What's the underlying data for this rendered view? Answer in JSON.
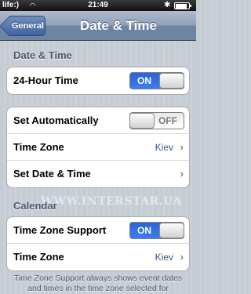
{
  "status_bar": {
    "carrier": "life:)",
    "wifi_icon": "wifi-icon",
    "time": "21:49",
    "bluetooth_icon": "bluetooth-icon",
    "battery_icon": "battery-icon",
    "battery_level": 0.8
  },
  "nav": {
    "back_label": "General",
    "title": "Date & Time"
  },
  "sections": {
    "date_time": {
      "header": "Date & Time",
      "hour24": {
        "label": "24-Hour Time",
        "state": "ON"
      }
    },
    "auto": {
      "set_automatically": {
        "label": "Set Automatically",
        "state": "OFF"
      },
      "time_zone": {
        "label": "Time Zone",
        "value": "Kiev"
      },
      "set_date_time": {
        "label": "Set Date & Time"
      }
    },
    "calendar": {
      "header": "Calendar",
      "tz_support": {
        "label": "Time Zone Support",
        "state": "ON"
      },
      "time_zone": {
        "label": "Time Zone",
        "value": "Kiev"
      }
    }
  },
  "footer_note": "Time Zone Support always shows event dates and times in the time zone selected for",
  "watermark": "WWW.INTERSTAR.UA",
  "colors": {
    "accent_blue": "#3c7df0",
    "nav_blue": "#6d84a2",
    "value_text": "#385487",
    "background": "#c5ccd4"
  }
}
